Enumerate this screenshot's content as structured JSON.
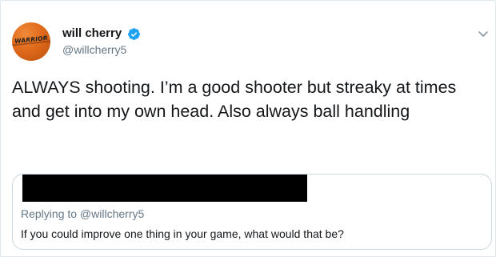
{
  "author": {
    "display_name": "will cherry",
    "handle": "@willcherry5",
    "verified": true,
    "avatar_text": "WARRIOR",
    "avatar_color": "#e06a1c"
  },
  "tweet": {
    "text": "ALWAYS shooting. I’m a good shooter but streaky at times and get into my own head. Also always ball handling"
  },
  "quoted_tweet": {
    "redacted": true,
    "reply_context": "Replying to @willcherry5",
    "text": "If you could improve one thing in your game, what would that be?"
  },
  "icons": {
    "verified": "verified-badge-icon",
    "menu": "chevron-down-icon"
  },
  "colors": {
    "verified_blue": "#1da1f2",
    "secondary_text": "#657786",
    "border": "#ccd6dd"
  }
}
